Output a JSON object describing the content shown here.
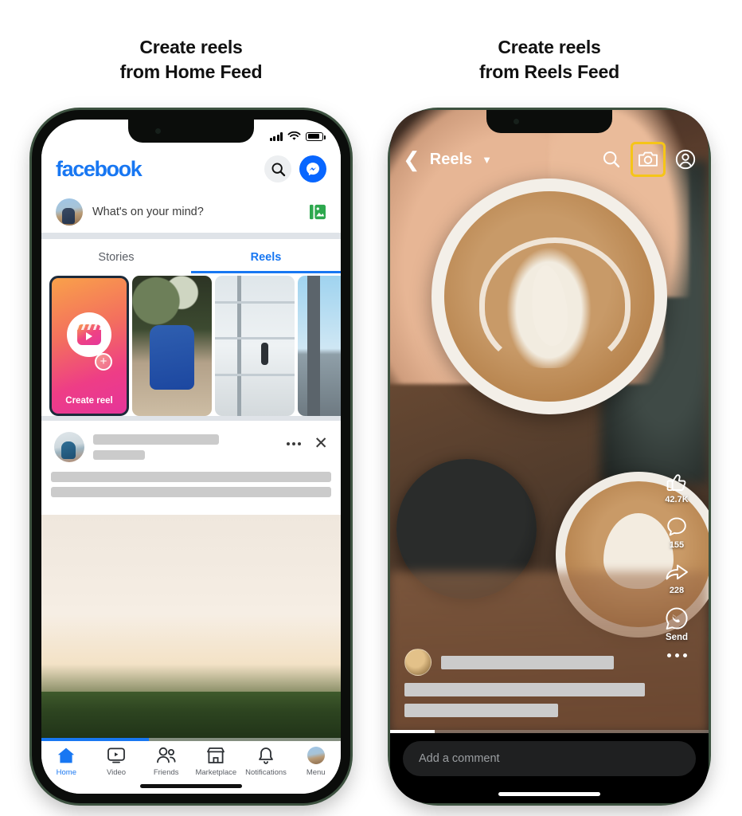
{
  "captions": {
    "left": {
      "line1": "Create reels",
      "line2": "from Home Feed"
    },
    "right": {
      "line1": "Create reels",
      "line2": "from Reels Feed"
    }
  },
  "colors": {
    "facebook_blue": "#1877F2",
    "messenger_blue": "#0866FF",
    "highlight_yellow": "#F5C518",
    "placeholder_gray": "#CBCBCB",
    "frame_green": "#3D5240"
  },
  "left_phone": {
    "status_bar": {
      "signal_icon": "cellular-bars-icon",
      "wifi_icon": "wifi-icon",
      "battery_icon": "battery-icon"
    },
    "header": {
      "logo": "facebook",
      "search_icon": "search-icon",
      "messenger_icon": "messenger-icon"
    },
    "composer": {
      "avatar": "user-avatar",
      "placeholder": "What's on your mind?",
      "photo_icon": "photo-library-icon"
    },
    "tabs": [
      {
        "label": "Stories",
        "active": false
      },
      {
        "label": "Reels",
        "active": true
      }
    ],
    "reels_carousel": [
      {
        "label": "Create reel",
        "type": "create-card",
        "selected": true
      },
      {
        "label": "",
        "type": "thumbnail-backpack"
      },
      {
        "label": "",
        "type": "thumbnail-airport"
      },
      {
        "label": "",
        "type": "thumbnail-sky"
      }
    ],
    "post": {
      "menu_icon": "more-options-icon",
      "close_icon": "close-icon",
      "avatar": "post-author-avatar",
      "media": "family-walking-in-field-photo",
      "progress_percent": 36
    },
    "bottom_nav": [
      {
        "label": "Home",
        "icon": "home-icon",
        "active": true
      },
      {
        "label": "Video",
        "icon": "video-icon",
        "active": false
      },
      {
        "label": "Friends",
        "icon": "friends-icon",
        "active": false
      },
      {
        "label": "Marketplace",
        "icon": "marketplace-icon",
        "active": false
      },
      {
        "label": "Notifications",
        "icon": "bell-icon",
        "active": false
      },
      {
        "label": "Menu",
        "icon": "menu-avatar-icon",
        "active": false
      }
    ]
  },
  "right_phone": {
    "header": {
      "back_icon": "chevron-left-icon",
      "title": "Reels",
      "dropdown_icon": "chevron-down-icon",
      "search_icon": "search-icon",
      "camera_icon": "camera-icon",
      "camera_highlighted": true,
      "profile_icon": "profile-icon"
    },
    "background": "coffee-latte-art-photo",
    "actions": [
      {
        "icon": "thumbs-up-icon",
        "count": "42.7K"
      },
      {
        "icon": "comment-icon",
        "count": "155"
      },
      {
        "icon": "share-icon",
        "count": "228"
      },
      {
        "icon": "send-icon",
        "label": "Send"
      },
      {
        "icon": "more-options-icon",
        "label": ""
      }
    ],
    "caption": {
      "avatar": "reel-author-avatar"
    },
    "comment_bar": {
      "placeholder": "Add a comment"
    },
    "progress_percent": 14
  }
}
